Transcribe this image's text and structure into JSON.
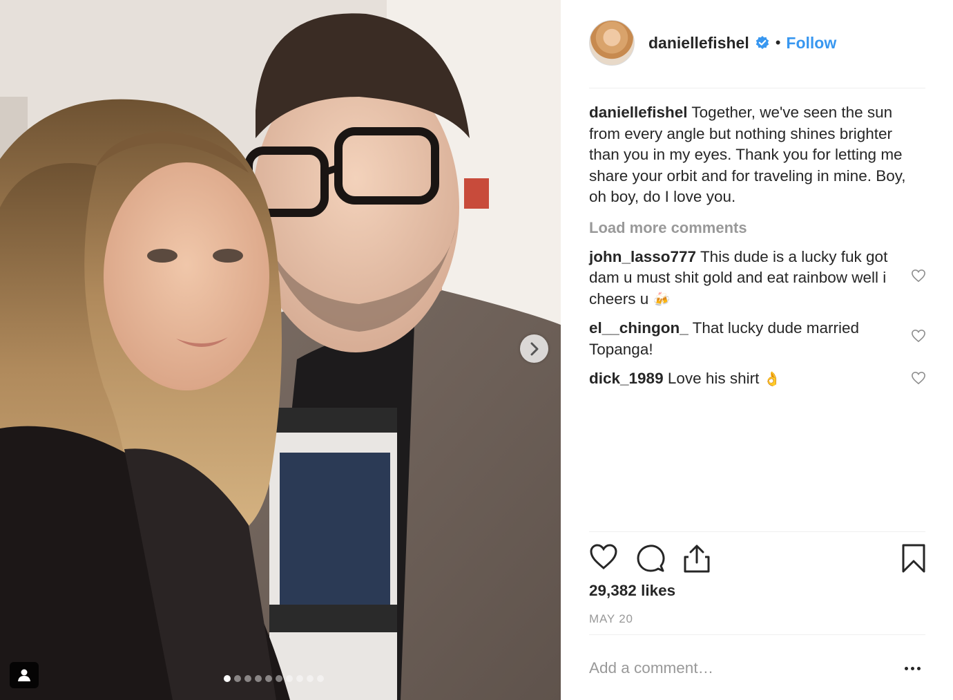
{
  "post": {
    "image_alt": "Selfie of a woman with long blonde hair and a man with glasses and a beard",
    "carousel_count": 10,
    "carousel_active": 0
  },
  "header": {
    "username": "daniellefishel",
    "verified": true,
    "separator": "•",
    "follow_label": "Follow"
  },
  "caption": {
    "username": "daniellefishel",
    "text": "Together, we've seen the sun from every angle but nothing shines brighter than you in my eyes. Thank you for letting me share your orbit and for traveling in mine. Boy, oh boy, do I love you."
  },
  "load_more_label": "Load more comments",
  "comments": [
    {
      "username": "john_lasso777",
      "text": "This dude is a lucky fuk got dam u must shit gold and eat rainbow well i cheers u",
      "emoji": "🍻"
    },
    {
      "username": "el__chingon_",
      "text": "That lucky dude married Topanga!",
      "emoji": ""
    },
    {
      "username": "dick_1989",
      "text": "Love his shirt",
      "emoji": "👌"
    }
  ],
  "likes": "29,382 likes",
  "date": "MAY 20",
  "add_comment_placeholder": "Add a comment…",
  "icons": {
    "like": "heart-icon",
    "comment": "comment-bubble-icon",
    "share": "share-icon",
    "save": "bookmark-icon",
    "more": "more-options-icon",
    "next": "chevron-right-icon",
    "tag": "user-tag-icon",
    "verified": "verified-badge-icon"
  },
  "colors": {
    "link": "#3897f0",
    "text": "#262626",
    "muted": "#999999",
    "divider": "#efefef"
  }
}
